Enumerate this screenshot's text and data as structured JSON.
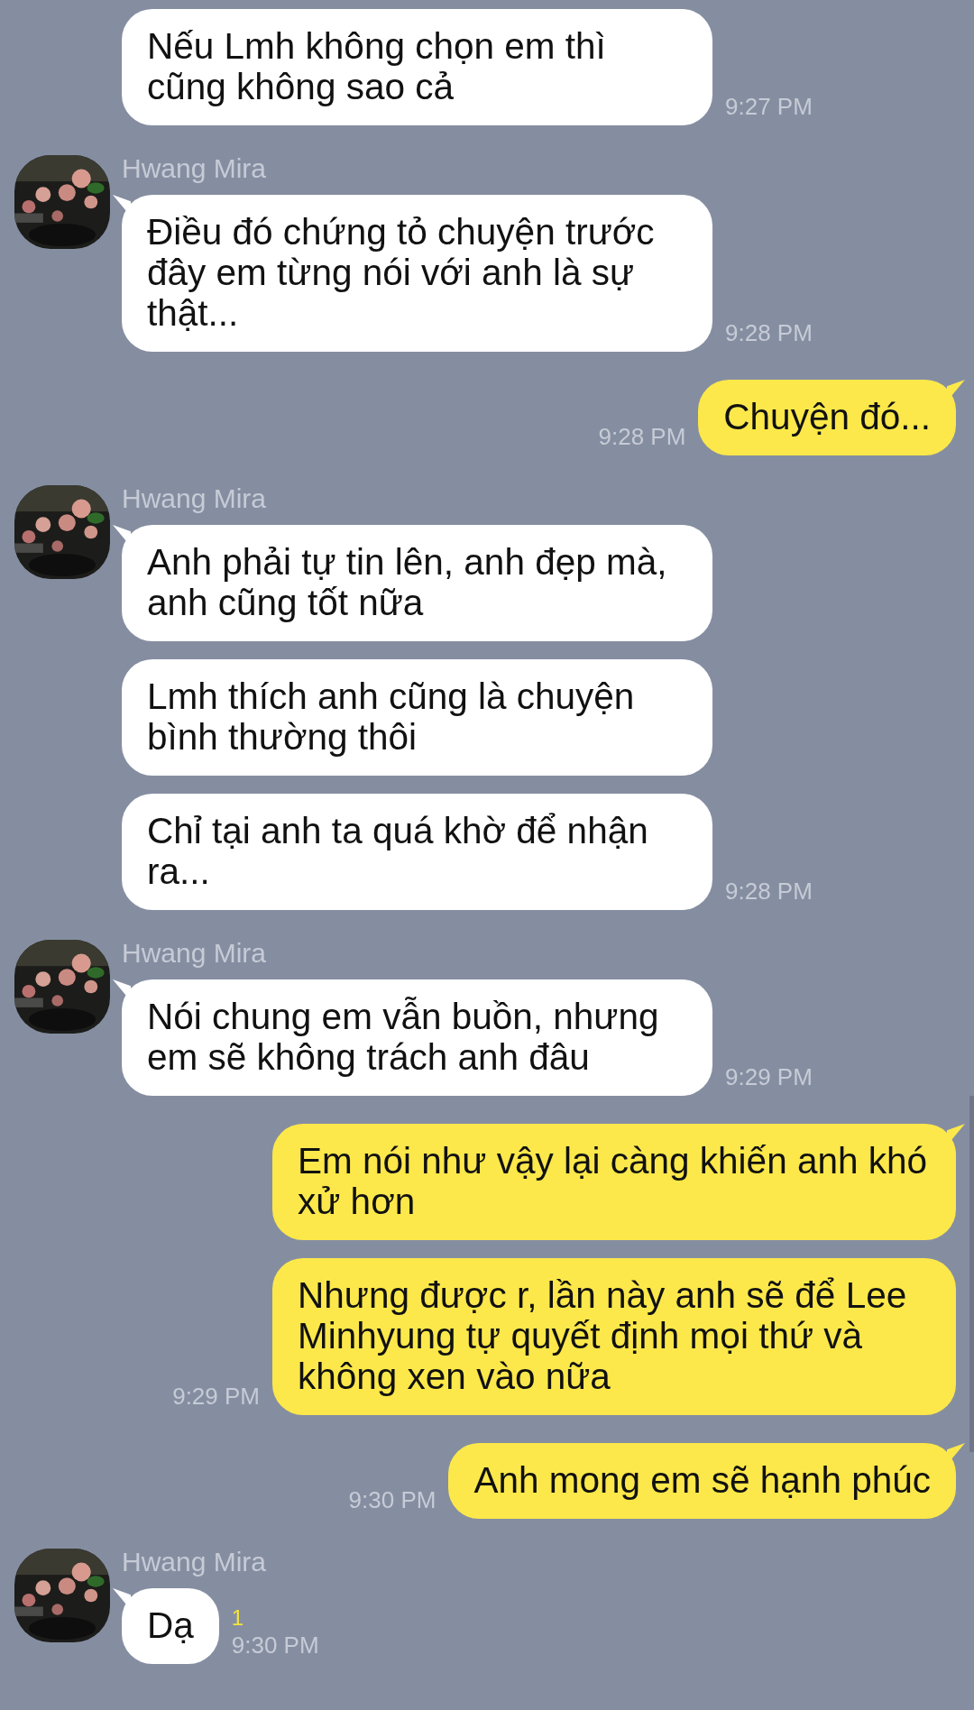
{
  "messages": [
    {
      "kind": "received",
      "bubbles": [
        {
          "text": "Nếu Lmh không chọn em thì cũng không sao cả",
          "time": "9:27 PM",
          "tail": false
        }
      ]
    },
    {
      "kind": "received",
      "sender": "Hwang Mira",
      "bubbles": [
        {
          "text": "Điều đó chứng tỏ chuyện trước đây em từng nói với anh là sự thật...",
          "time": "9:28 PM",
          "tail": true
        }
      ]
    },
    {
      "kind": "sent",
      "bubbles": [
        {
          "text": "Chuyện đó...",
          "time": "9:28 PM",
          "tail": true
        }
      ]
    },
    {
      "kind": "received",
      "sender": "Hwang Mira",
      "bubbles": [
        {
          "text": "Anh phải tự tin lên, anh đẹp mà, anh cũng tốt nữa",
          "tail": true
        },
        {
          "text": "Lmh thích anh cũng là chuyện bình thường thôi",
          "tail": false
        },
        {
          "text": "Chỉ tại anh ta quá khờ để nhận ra...",
          "time": "9:28 PM",
          "tail": false
        }
      ]
    },
    {
      "kind": "received",
      "sender": "Hwang Mira",
      "bubbles": [
        {
          "text": "Nói chung em vẫn buồn, nhưng em sẽ không trách anh đâu",
          "time": "9:29 PM",
          "tail": true
        }
      ]
    },
    {
      "kind": "sent",
      "bubbles": [
        {
          "text": "Em nói như vậy lại càng khiến anh khó xử hơn",
          "tail": true
        },
        {
          "text": "Nhưng được r, lần này anh sẽ để Lee Minhyung tự quyết định mọi thứ và không xen vào nữa",
          "time": "9:29 PM",
          "tail": false
        }
      ]
    },
    {
      "kind": "sent",
      "bubbles": [
        {
          "text": "Anh mong em sẽ hạnh phúc",
          "time": "9:30 PM",
          "tail": true
        }
      ]
    },
    {
      "kind": "received",
      "sender": "Hwang Mira",
      "bubbles": [
        {
          "text": "Dạ",
          "unread": "1",
          "time": "9:30 PM",
          "tail": true
        }
      ]
    }
  ]
}
